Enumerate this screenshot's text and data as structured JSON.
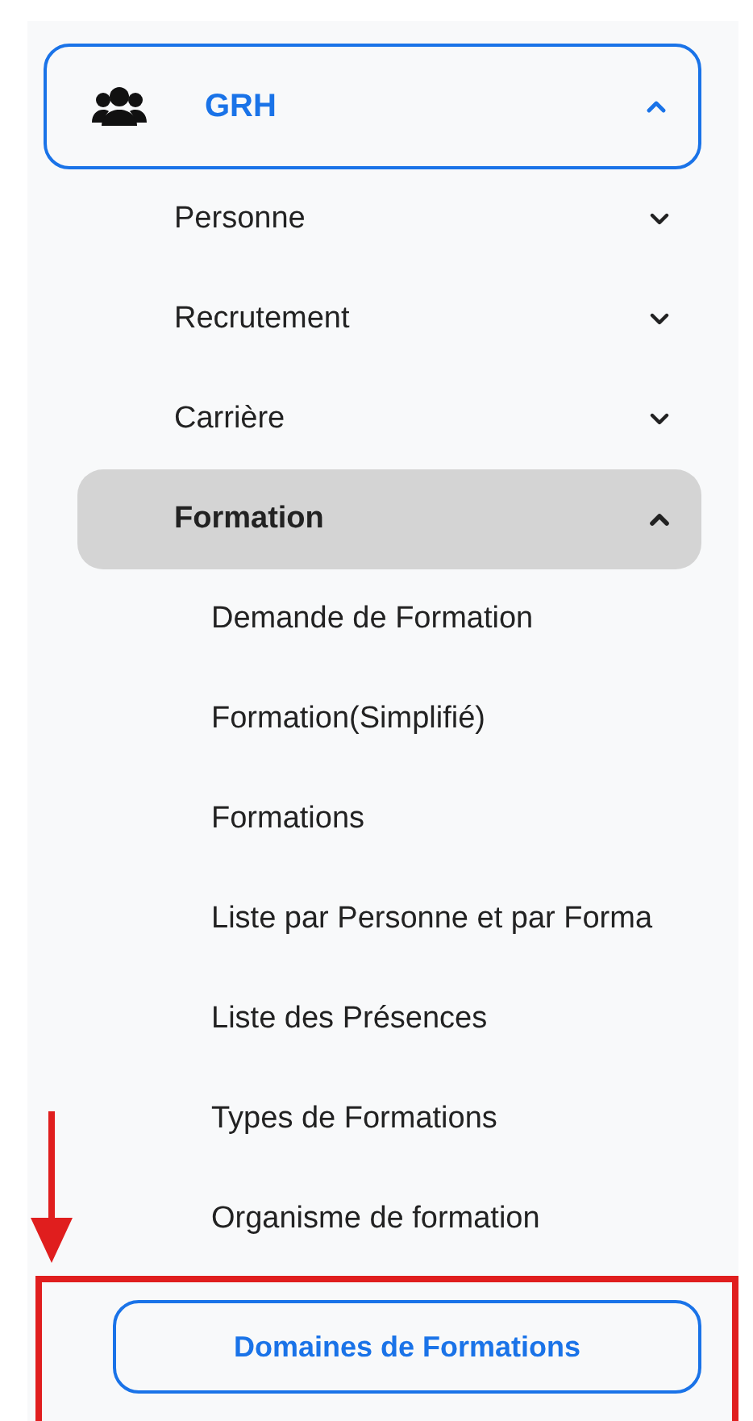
{
  "menu": {
    "label": "GRH",
    "expanded": true,
    "selected": true,
    "children": [
      {
        "label": "Personne",
        "expanded": false,
        "highlighted": false
      },
      {
        "label": "Recrutement",
        "expanded": false,
        "highlighted": false
      },
      {
        "label": "Carrière",
        "expanded": false,
        "highlighted": false
      },
      {
        "label": "Formation",
        "expanded": true,
        "highlighted": true,
        "children": [
          {
            "label": "Demande de Formation",
            "selected": false,
            "annotated": false
          },
          {
            "label": "Formation(Simplifié)",
            "selected": false,
            "annotated": false
          },
          {
            "label": "Formations",
            "selected": false,
            "annotated": false
          },
          {
            "label": "Liste par Personne et par Forma",
            "selected": false,
            "annotated": false
          },
          {
            "label": "Liste des Présences",
            "selected": false,
            "annotated": false
          },
          {
            "label": "Types de Formations",
            "selected": false,
            "annotated": false
          },
          {
            "label": "Organisme de formation",
            "selected": false,
            "annotated": false
          },
          {
            "label": "Domaines de Formations",
            "selected": true,
            "annotated": true
          }
        ]
      }
    ]
  }
}
